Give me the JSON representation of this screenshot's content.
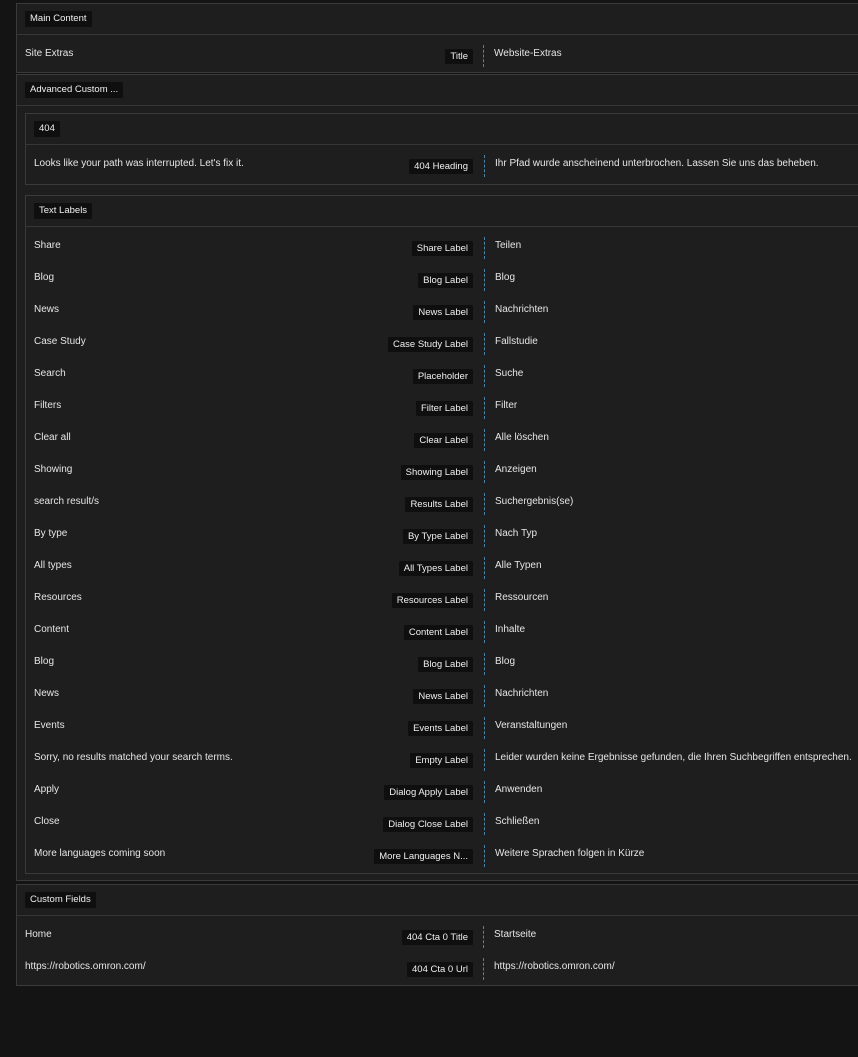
{
  "main_content": {
    "label": "Main Content",
    "rows": [
      {
        "source": "Site Extras",
        "field": "Title",
        "translation": "Website-Extras"
      }
    ]
  },
  "acf": {
    "label": "Advanced Custom ...",
    "section_404": {
      "label": "404",
      "rows": [
        {
          "source": "Looks like your path was interrupted. Let's fix it.",
          "field": "404 Heading",
          "translation": "Ihr Pfad wurde anscheinend unterbrochen. Lassen Sie uns das beheben."
        }
      ]
    },
    "text_labels": {
      "label": "Text Labels",
      "rows": [
        {
          "source": "Share",
          "field": "Share Label",
          "translation": "Teilen"
        },
        {
          "source": "Blog",
          "field": "Blog Label",
          "translation": "Blog"
        },
        {
          "source": "News",
          "field": "News Label",
          "translation": "Nachrichten"
        },
        {
          "source": "Case Study",
          "field": "Case Study Label",
          "translation": "Fallstudie"
        },
        {
          "source": "Search",
          "field": "Placeholder",
          "translation": "Suche"
        },
        {
          "source": "Filters",
          "field": "Filter Label",
          "translation": "Filter"
        },
        {
          "source": "Clear all",
          "field": "Clear Label",
          "translation": "Alle löschen"
        },
        {
          "source": "Showing",
          "field": "Showing Label",
          "translation": "Anzeigen"
        },
        {
          "source": "search result/s",
          "field": "Results Label",
          "translation": "Suchergebnis(se)"
        },
        {
          "source": "By type",
          "field": "By Type Label",
          "translation": "Nach Typ"
        },
        {
          "source": "All types",
          "field": "All Types Label",
          "translation": "Alle Typen"
        },
        {
          "source": "Resources",
          "field": "Resources Label",
          "translation": "Ressourcen"
        },
        {
          "source": "Content",
          "field": "Content Label",
          "translation": "Inhalte"
        },
        {
          "source": "Blog",
          "field": "Blog Label",
          "translation": "Blog"
        },
        {
          "source": "News",
          "field": "News Label",
          "translation": "Nachrichten"
        },
        {
          "source": "Events",
          "field": "Events Label",
          "translation": "Veranstaltungen"
        },
        {
          "source": "Sorry, no results matched your search terms.",
          "field": "Empty Label",
          "translation": "Leider wurden keine Ergebnisse gefunden, die Ihren Suchbegriffen entsprechen."
        },
        {
          "source": "Apply",
          "field": "Dialog Apply Label",
          "translation": "Anwenden"
        },
        {
          "source": "Close",
          "field": "Dialog Close Label",
          "translation": "Schließen"
        },
        {
          "source": "More languages coming soon",
          "field": "More Languages N...",
          "translation": "Weitere Sprachen folgen in Kürze"
        }
      ]
    }
  },
  "custom_fields": {
    "label": "Custom Fields",
    "rows": [
      {
        "source": "Home",
        "field": "404 Cta 0 Title",
        "translation": "Startseite"
      },
      {
        "source": "https://robotics.omron.com/",
        "field": "404 Cta 0 Url",
        "translation": "https://robotics.omron.com/"
      }
    ]
  }
}
